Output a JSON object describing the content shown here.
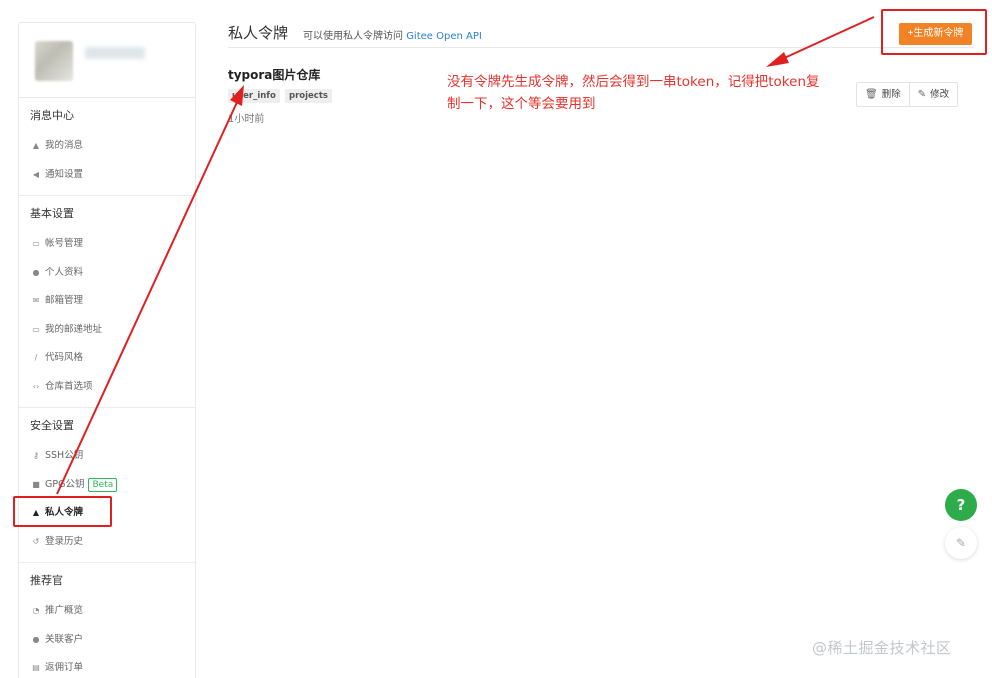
{
  "sidebar": {
    "groups": [
      {
        "title": "消息中心",
        "items": [
          {
            "label": "我的消息",
            "icon": "bell-icon"
          },
          {
            "label": "通知设置",
            "icon": "speaker-icon"
          }
        ]
      },
      {
        "title": "基本设置",
        "items": [
          {
            "label": "帐号管理",
            "icon": "id-card-icon"
          },
          {
            "label": "个人资料",
            "icon": "user-icon"
          },
          {
            "label": "邮箱管理",
            "icon": "mail-icon"
          },
          {
            "label": "我的邮递地址",
            "icon": "address-card-icon"
          },
          {
            "label": "代码风格",
            "icon": "brush-icon"
          },
          {
            "label": "仓库首选项",
            "icon": "code-icon"
          }
        ]
      },
      {
        "title": "安全设置",
        "items": [
          {
            "label": "SSH公钥",
            "icon": "key-icon"
          },
          {
            "label": "GPG公钥",
            "icon": "lock-icon",
            "badge": "Beta"
          },
          {
            "label": "私人令牌",
            "icon": "token-icon",
            "active": true
          },
          {
            "label": "登录历史",
            "icon": "history-icon"
          }
        ]
      },
      {
        "title": "推荐官",
        "items": [
          {
            "label": "推广概览",
            "icon": "chart-icon"
          },
          {
            "label": "关联客户",
            "icon": "users-icon"
          },
          {
            "label": "返佣订单",
            "icon": "order-icon"
          }
        ]
      }
    ]
  },
  "header": {
    "title": "私人令牌",
    "subtitle_prefix": "可以使用私人令牌访问",
    "subtitle_link": "Gitee Open API",
    "generate_button": "+生成新令牌"
  },
  "token": {
    "name": "typora图片仓库",
    "scopes": [
      "user_info",
      "projects"
    ],
    "time": "1小时前",
    "delete_label": "删除",
    "edit_label": "修改"
  },
  "annotation": {
    "note": "没有令牌先生成令牌，然后会得到一串token，记得把token复制一下，这个等会要用到"
  },
  "float_buttons": {
    "help": "?"
  },
  "watermark": "@稀土掘金技术社区",
  "colors": {
    "accent_orange": "#f18326",
    "annotation_red": "#e8322b",
    "help_green": "#2eab4a",
    "link_blue": "#2d7fd0"
  }
}
